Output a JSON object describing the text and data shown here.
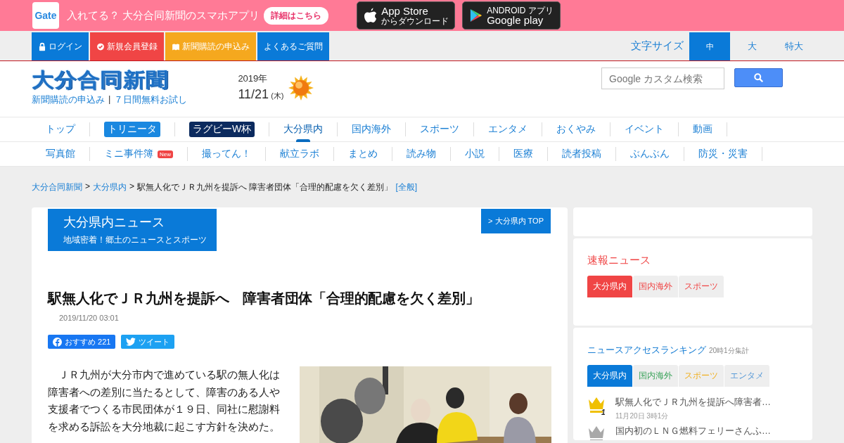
{
  "app_banner": {
    "logo": "Gate",
    "text": "入れてる？ 大分合同新聞のスマホアプリ",
    "button": "詳細はこちら",
    "stores": [
      {
        "kind": "apple",
        "label": "App Store",
        "sub": "からダウンロード"
      },
      {
        "kind": "google",
        "top": "ANDROID アプリ",
        "label": "Google play"
      }
    ]
  },
  "top_nav": {
    "links": [
      {
        "kind": "lock",
        "label": "ログイン",
        "color": "#0a7ad8"
      },
      {
        "kind": "check",
        "label": "新規会員登録",
        "color": "#f04545"
      },
      {
        "kind": "book",
        "label": "新聞購読の申込み",
        "color": "#f5a81e"
      },
      {
        "kind": "none",
        "label": "よくあるご質問",
        "color": "#0a7ad8"
      }
    ],
    "font_size": {
      "label": "文字サイズ",
      "options": [
        {
          "label": "中",
          "selected": true
        },
        {
          "label": "大",
          "selected": false
        },
        {
          "label": "特大",
          "selected": false
        }
      ]
    }
  },
  "header": {
    "logo": "大分合同新聞",
    "links": [
      "新聞購読の申込み",
      "７日間無料お試し"
    ],
    "separator": "|",
    "year": "2019年",
    "date": "11/21",
    "weekday": "(木)",
    "search": {
      "placeholder": "Google カスタム検索"
    }
  },
  "main_nav": [
    {
      "label": "トップ",
      "kind": "link",
      "selected": false
    },
    {
      "label": "トリニータ",
      "kind": "pill",
      "selected": false
    },
    {
      "label": "ラグビーW杯",
      "kind": "pill-dark",
      "selected": false
    },
    {
      "label": "大分県内",
      "kind": "link",
      "selected": true
    },
    {
      "label": "国内海外",
      "kind": "link",
      "selected": false
    },
    {
      "label": "スポーツ",
      "kind": "link",
      "selected": false
    },
    {
      "label": "エンタメ",
      "kind": "link",
      "selected": false
    },
    {
      "label": "おくやみ",
      "kind": "link",
      "selected": false
    },
    {
      "label": "イベント",
      "kind": "link",
      "selected": false
    },
    {
      "label": "動画",
      "kind": "link",
      "selected": false
    }
  ],
  "sub_nav": [
    {
      "label": "写真館"
    },
    {
      "label": "ミニ事件簿",
      "badge": "New"
    },
    {
      "label": "撮ってん！"
    },
    {
      "label": "献立ラボ"
    },
    {
      "label": "まとめ"
    },
    {
      "label": "読み物"
    },
    {
      "label": "小説"
    },
    {
      "label": "医療"
    },
    {
      "label": "読者投稿"
    },
    {
      "label": "ぶんぶん"
    },
    {
      "label": "防災・災害"
    }
  ],
  "breadcrumb": {
    "links": [
      "大分合同新聞",
      "大分県内"
    ],
    "separator": ">",
    "current": "駅無人化でＪＲ九州を提訴へ 障害者団体「合理的配慮を欠く差別」",
    "category": "[全般]"
  },
  "article": {
    "section_title": "大分県内ニュース",
    "section_subtitle": "地域密着！郷土のニュースとスポーツ",
    "top_link": "> 大分県内 TOP",
    "headline": "駅無人化でＪＲ九州を提訴へ　障害者団体「合理的配慮を欠く差別」",
    "date": "2019/11/20 03:01",
    "share": [
      {
        "kind": "facebook",
        "label": "おすすめ",
        "count": "221"
      },
      {
        "kind": "twitter",
        "label": "ツイート"
      }
    ],
    "body": "ＪＲ九州が大分市内で進めている駅の無人化は障害者への差別に当たるとして、障害のある人や支援者でつくる市民団体が１９日、同社に慰謝料を求める訴訟を大分地裁に起こす方針を決めた。"
  },
  "sidebar": {
    "breaking": {
      "title": "速報ニュース",
      "tabs": [
        {
          "label": "大分県内",
          "selected": true
        },
        {
          "label": "国内海外",
          "selected": false
        },
        {
          "label": "スポーツ",
          "selected": false
        }
      ]
    },
    "ranking": {
      "title": "ニュースアクセスランキング",
      "note": "20時1分集計",
      "tabs": [
        {
          "label": "大分県内",
          "kind": "local",
          "selected": true
        },
        {
          "label": "国内海外",
          "kind": "national",
          "selected": false
        },
        {
          "label": "スポーツ",
          "kind": "sports",
          "selected": false
        },
        {
          "label": "エンタメ",
          "kind": "entertainment",
          "selected": false
        }
      ],
      "items": [
        {
          "rank": "1",
          "color": "#f0c000",
          "title": "駅無人化でＪＲ九州を提訴へ障害者…",
          "time": "11月20日 3時1分"
        },
        {
          "color": "#a8a8a8",
          "title": "国内初のＬＮＧ燃料フェリーさんふ…"
        }
      ]
    }
  }
}
